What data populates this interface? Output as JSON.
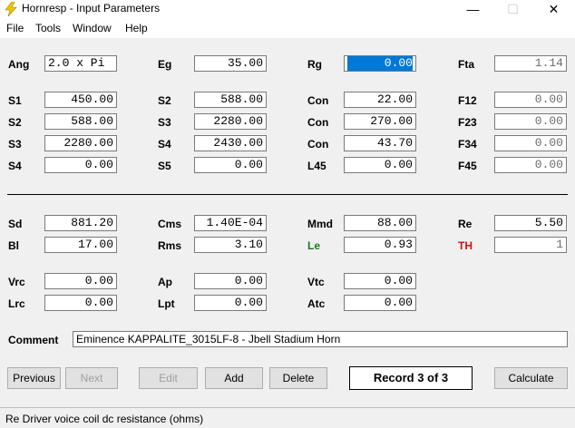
{
  "window": {
    "title": "Hornresp - Input Parameters",
    "controls": {
      "minimize": "—",
      "maximize": "☐",
      "close": "✕"
    }
  },
  "menu": [
    "File",
    "Tools",
    "Window",
    "Help"
  ],
  "params": {
    "ang": {
      "label": "Ang",
      "value": "2.0 x Pi"
    },
    "eg": {
      "label": "Eg",
      "value": "35.00"
    },
    "rg": {
      "label": "Rg",
      "value": "0.00"
    },
    "fta": {
      "label": "Fta",
      "value": "1.14"
    },
    "s1": {
      "label": "S1",
      "value": "450.00"
    },
    "s2a": {
      "label": "S2",
      "value": "588.00"
    },
    "con1": {
      "label": "Con",
      "value": "22.00"
    },
    "f12": {
      "label": "F12",
      "value": "0.00"
    },
    "s2b": {
      "label": "S2",
      "value": "588.00"
    },
    "s3a": {
      "label": "S3",
      "value": "2280.00"
    },
    "con2": {
      "label": "Con",
      "value": "270.00"
    },
    "f23": {
      "label": "F23",
      "value": "0.00"
    },
    "s3b": {
      "label": "S3",
      "value": "2280.00"
    },
    "s4a": {
      "label": "S4",
      "value": "2430.00"
    },
    "con3": {
      "label": "Con",
      "value": "43.70"
    },
    "f34": {
      "label": "F34",
      "value": "0.00"
    },
    "s4b": {
      "label": "S4",
      "value": "0.00"
    },
    "s5": {
      "label": "S5",
      "value": "0.00"
    },
    "l45": {
      "label": "L45",
      "value": "0.00"
    },
    "f45": {
      "label": "F45",
      "value": "0.00"
    },
    "sd": {
      "label": "Sd",
      "value": "881.20"
    },
    "cms": {
      "label": "Cms",
      "value": "1.40E-04"
    },
    "mmd": {
      "label": "Mmd",
      "value": "88.00"
    },
    "re": {
      "label": "Re",
      "value": "5.50"
    },
    "bl": {
      "label": "Bl",
      "value": "17.00"
    },
    "rms": {
      "label": "Rms",
      "value": "3.10"
    },
    "le": {
      "label": "Le",
      "value": "0.93"
    },
    "th": {
      "label": "TH",
      "value": "1"
    },
    "vrc": {
      "label": "Vrc",
      "value": "0.00"
    },
    "ap": {
      "label": "Ap",
      "value": "0.00"
    },
    "vtc": {
      "label": "Vtc",
      "value": "0.00"
    },
    "lrc": {
      "label": "Lrc",
      "value": "0.00"
    },
    "lpt": {
      "label": "Lpt",
      "value": "0.00"
    },
    "atc": {
      "label": "Atc",
      "value": "0.00"
    }
  },
  "comment": {
    "label": "Comment",
    "value": "Eminence KAPPALITE_3015LF-8 - Jbell Stadium Horn"
  },
  "buttons": {
    "previous": "Previous",
    "next": "Next",
    "edit": "Edit",
    "add": "Add",
    "delete": "Delete",
    "calculate": "Calculate"
  },
  "record": "Record 3 of 3",
  "status": "Re   Driver voice coil dc resistance  (ohms)",
  "colors": {
    "selection": "#0078d7",
    "le_label": "#1a7a1a",
    "th_label": "#d01010",
    "app_icon": "#f5c400"
  }
}
